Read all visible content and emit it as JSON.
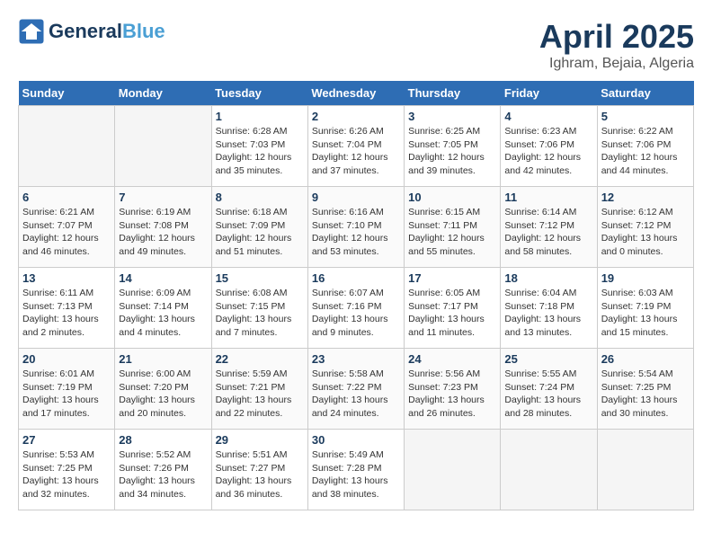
{
  "header": {
    "logo_line1": "General",
    "logo_line2": "Blue",
    "month": "April 2025",
    "location": "Ighram, Bejaia, Algeria"
  },
  "weekdays": [
    "Sunday",
    "Monday",
    "Tuesday",
    "Wednesday",
    "Thursday",
    "Friday",
    "Saturday"
  ],
  "weeks": [
    [
      {
        "day": "",
        "details": ""
      },
      {
        "day": "",
        "details": ""
      },
      {
        "day": "1",
        "details": "Sunrise: 6:28 AM\nSunset: 7:03 PM\nDaylight: 12 hours and 35 minutes."
      },
      {
        "day": "2",
        "details": "Sunrise: 6:26 AM\nSunset: 7:04 PM\nDaylight: 12 hours and 37 minutes."
      },
      {
        "day": "3",
        "details": "Sunrise: 6:25 AM\nSunset: 7:05 PM\nDaylight: 12 hours and 39 minutes."
      },
      {
        "day": "4",
        "details": "Sunrise: 6:23 AM\nSunset: 7:06 PM\nDaylight: 12 hours and 42 minutes."
      },
      {
        "day": "5",
        "details": "Sunrise: 6:22 AM\nSunset: 7:06 PM\nDaylight: 12 hours and 44 minutes."
      }
    ],
    [
      {
        "day": "6",
        "details": "Sunrise: 6:21 AM\nSunset: 7:07 PM\nDaylight: 12 hours and 46 minutes."
      },
      {
        "day": "7",
        "details": "Sunrise: 6:19 AM\nSunset: 7:08 PM\nDaylight: 12 hours and 49 minutes."
      },
      {
        "day": "8",
        "details": "Sunrise: 6:18 AM\nSunset: 7:09 PM\nDaylight: 12 hours and 51 minutes."
      },
      {
        "day": "9",
        "details": "Sunrise: 6:16 AM\nSunset: 7:10 PM\nDaylight: 12 hours and 53 minutes."
      },
      {
        "day": "10",
        "details": "Sunrise: 6:15 AM\nSunset: 7:11 PM\nDaylight: 12 hours and 55 minutes."
      },
      {
        "day": "11",
        "details": "Sunrise: 6:14 AM\nSunset: 7:12 PM\nDaylight: 12 hours and 58 minutes."
      },
      {
        "day": "12",
        "details": "Sunrise: 6:12 AM\nSunset: 7:12 PM\nDaylight: 13 hours and 0 minutes."
      }
    ],
    [
      {
        "day": "13",
        "details": "Sunrise: 6:11 AM\nSunset: 7:13 PM\nDaylight: 13 hours and 2 minutes."
      },
      {
        "day": "14",
        "details": "Sunrise: 6:09 AM\nSunset: 7:14 PM\nDaylight: 13 hours and 4 minutes."
      },
      {
        "day": "15",
        "details": "Sunrise: 6:08 AM\nSunset: 7:15 PM\nDaylight: 13 hours and 7 minutes."
      },
      {
        "day": "16",
        "details": "Sunrise: 6:07 AM\nSunset: 7:16 PM\nDaylight: 13 hours and 9 minutes."
      },
      {
        "day": "17",
        "details": "Sunrise: 6:05 AM\nSunset: 7:17 PM\nDaylight: 13 hours and 11 minutes."
      },
      {
        "day": "18",
        "details": "Sunrise: 6:04 AM\nSunset: 7:18 PM\nDaylight: 13 hours and 13 minutes."
      },
      {
        "day": "19",
        "details": "Sunrise: 6:03 AM\nSunset: 7:19 PM\nDaylight: 13 hours and 15 minutes."
      }
    ],
    [
      {
        "day": "20",
        "details": "Sunrise: 6:01 AM\nSunset: 7:19 PM\nDaylight: 13 hours and 17 minutes."
      },
      {
        "day": "21",
        "details": "Sunrise: 6:00 AM\nSunset: 7:20 PM\nDaylight: 13 hours and 20 minutes."
      },
      {
        "day": "22",
        "details": "Sunrise: 5:59 AM\nSunset: 7:21 PM\nDaylight: 13 hours and 22 minutes."
      },
      {
        "day": "23",
        "details": "Sunrise: 5:58 AM\nSunset: 7:22 PM\nDaylight: 13 hours and 24 minutes."
      },
      {
        "day": "24",
        "details": "Sunrise: 5:56 AM\nSunset: 7:23 PM\nDaylight: 13 hours and 26 minutes."
      },
      {
        "day": "25",
        "details": "Sunrise: 5:55 AM\nSunset: 7:24 PM\nDaylight: 13 hours and 28 minutes."
      },
      {
        "day": "26",
        "details": "Sunrise: 5:54 AM\nSunset: 7:25 PM\nDaylight: 13 hours and 30 minutes."
      }
    ],
    [
      {
        "day": "27",
        "details": "Sunrise: 5:53 AM\nSunset: 7:25 PM\nDaylight: 13 hours and 32 minutes."
      },
      {
        "day": "28",
        "details": "Sunrise: 5:52 AM\nSunset: 7:26 PM\nDaylight: 13 hours and 34 minutes."
      },
      {
        "day": "29",
        "details": "Sunrise: 5:51 AM\nSunset: 7:27 PM\nDaylight: 13 hours and 36 minutes."
      },
      {
        "day": "30",
        "details": "Sunrise: 5:49 AM\nSunset: 7:28 PM\nDaylight: 13 hours and 38 minutes."
      },
      {
        "day": "",
        "details": ""
      },
      {
        "day": "",
        "details": ""
      },
      {
        "day": "",
        "details": ""
      }
    ]
  ]
}
